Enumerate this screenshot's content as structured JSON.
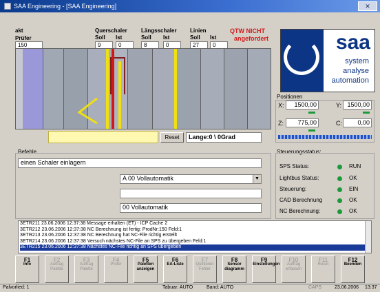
{
  "window": {
    "title": "SAA Engineering - [SAA Engineering]",
    "close": "✕"
  },
  "top": {
    "akt": "akt",
    "pruefer": "Prüfer",
    "pruefer_value": "150",
    "quer": "Querschaler",
    "laengs": "Längsschaler",
    "linien": "Linien",
    "soll": "Soll",
    "ist": "Ist",
    "values": [
      "9",
      "0",
      "8",
      "0",
      "27",
      "0"
    ],
    "warn1": "QTW NICHT",
    "warn2": "angefordert"
  },
  "logo": {
    "name": "saa",
    "line1": "system",
    "line2": "analyse",
    "line3": "automation"
  },
  "machine": {
    "reset": "Reset",
    "length": "Lange:0 \\ 0Grad"
  },
  "positions": {
    "title": "Positionen",
    "x_label": "X:",
    "x": "1500,00",
    "y_label": "Y:",
    "y": "1500,00",
    "z_label": "Z:",
    "z": "775,00",
    "c_label": "C:",
    "c": "0,00"
  },
  "befehle": {
    "label": "Befehle",
    "command": "einen Schaler einlagern",
    "mode_select": "A 00 Vollautomatik",
    "mode_text": "00 Vollautomatik"
  },
  "status": {
    "title": "Steuerungsstatus:",
    "rows": [
      {
        "k": "SPS Status:",
        "v": "RUN"
      },
      {
        "k": "Lightbus Status:",
        "v": "OK"
      },
      {
        "k": "Steuerung:",
        "v": "EIN"
      },
      {
        "k": "CAD Berechnung",
        "v": "OK"
      },
      {
        "k": "NC Berechnung:",
        "v": "OK"
      }
    ]
  },
  "log": [
    "3ETR211 23.06.2006 12:37:38 Message erhalten (ET) - ICP Cache 2",
    "3ETR212 23.06.2006 12:37:38  NC Berechnung ist fertig: ProdNr:150 Feld:1",
    "3ETR213 23.06.2006 12:37:38  NC Berechnung hat NC-File richtig erstellt",
    "3ETR214 23.06.2006 12:37:38  Versuch nächstes NC-File an SPS zu übergeben  Feld:1",
    "3ETR215 23.06.2006 12:37:38  Nächstes NC-File richtig an SPS übergeben"
  ],
  "fkeys": [
    {
      "fn": "F1",
      "label": "Info",
      "on": true
    },
    {
      "fn": "F2",
      "label": "Auftrag Palette",
      "on": false
    },
    {
      "fn": "F3",
      "label": "Auftrag Palette",
      "on": false
    },
    {
      "fn": "F4",
      "label": "Prüfer",
      "on": false
    },
    {
      "fn": "F5",
      "label": "Paletten anzeigen",
      "on": true
    },
    {
      "fn": "F6",
      "label": "EA-Liste",
      "on": true
    },
    {
      "fn": "F7",
      "label": "Quittieren Fehler",
      "on": false
    },
    {
      "fn": "F8",
      "label": "Sensor diagramm",
      "on": true
    },
    {
      "fn": "F9",
      "label": "Einstellungen",
      "on": true
    },
    {
      "fn": "F10",
      "label": "Auftrag erfassen",
      "on": false
    },
    {
      "fn": "F11",
      "label": "Reset",
      "on": false
    },
    {
      "fn": "F12",
      "label": "Beenden",
      "on": true
    }
  ],
  "statusbar": {
    "left": "Palvorlied: 1",
    "mid1": "Tabuar: AUTO",
    "mid2": "Band: AUTO",
    "caps": "CAPS",
    "date": "23.06.2006",
    "time": "13:37"
  },
  "colors": {
    "yellow": "#f0e010",
    "red": "#d01818",
    "green": "#1a9a3a",
    "brand": "#0d3585"
  }
}
